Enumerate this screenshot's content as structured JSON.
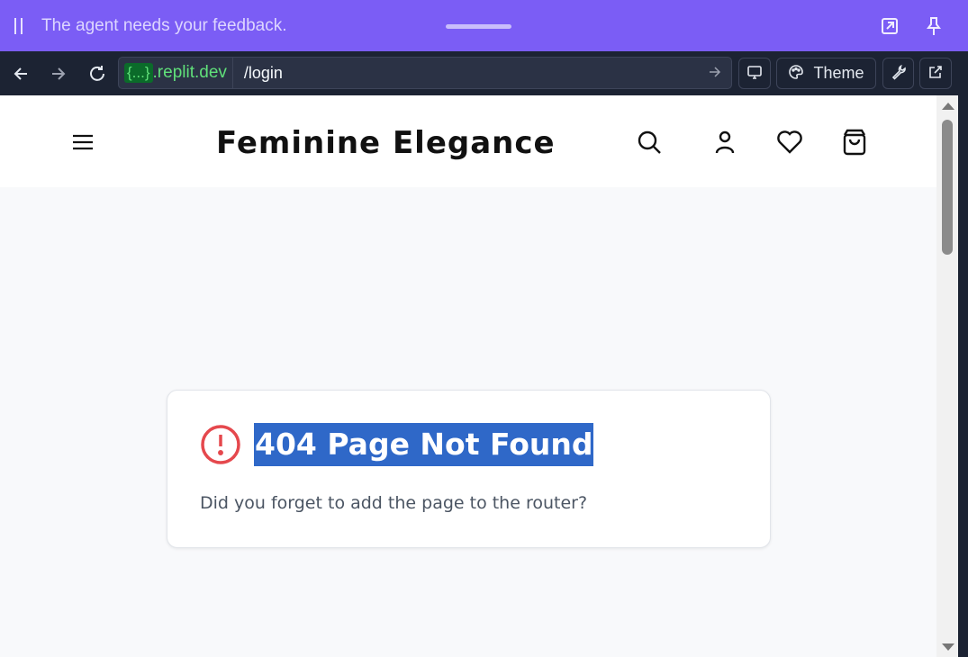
{
  "agent_banner": {
    "message": "The agent needs your feedback."
  },
  "browser": {
    "url_domain_pill": "{...}",
    "url_domain_rest": ".replit.dev",
    "url_path": "/login",
    "theme_label": "Theme"
  },
  "site": {
    "brand": "Feminine Elegance"
  },
  "error_card": {
    "title": "404 Page Not Found",
    "message": "Did you forget to add the page to the router?"
  },
  "colors": {
    "agent_banner": "#7b5df5",
    "toolbar": "#1c2333",
    "domain_text": "#60e07a",
    "error_icon": "#e5484d",
    "selection_highlight": "#2f68c8"
  }
}
